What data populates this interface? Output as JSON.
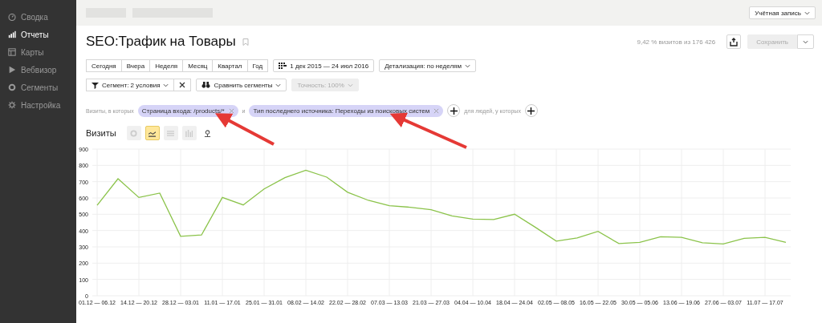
{
  "sidebar": {
    "items": [
      {
        "label": "Сводка",
        "selected": false
      },
      {
        "label": "Отчеты",
        "selected": true
      },
      {
        "label": "Карты",
        "selected": false
      },
      {
        "label": "Вебвизор",
        "selected": false
      },
      {
        "label": "Сегменты",
        "selected": false
      },
      {
        "label": "Настройка",
        "selected": false
      }
    ]
  },
  "header": {
    "account_button": "Учётная запись"
  },
  "report": {
    "title": "SEO:Трафик на Товары",
    "visits_share": "9,42 % визитов из 176 426",
    "save_button": {
      "label": "Сохранить",
      "disabled": true
    }
  },
  "periods": [
    {
      "label": "Сегодня",
      "selected": false
    },
    {
      "label": "Вчера",
      "selected": false
    },
    {
      "label": "Неделя",
      "selected": false
    },
    {
      "label": "Месяц",
      "selected": false
    },
    {
      "label": "Квартал",
      "selected": false
    },
    {
      "label": "Год",
      "selected": false
    }
  ],
  "date_range": "1 дек 2015 — 24 июл 2016",
  "detail": "Детализация: по неделям",
  "segment": "Сегмент: 2 условия",
  "compare": "Сравнить сегменты",
  "accuracy": {
    "label": "Точность: 100%",
    "disabled": true
  },
  "filter": {
    "prefix": "Визиты, в которых",
    "conditions": [
      "Страница входа: /products/*",
      "Тип последнего источника: Переходы из поисковых систем"
    ],
    "joiner": "и",
    "people_label": "для людей, у которых"
  },
  "chart": {
    "title": "Визиты",
    "view_modes": [
      {
        "selected": false,
        "disabled": true
      },
      {
        "selected": true,
        "disabled": false
      },
      {
        "selected": false,
        "disabled": true
      },
      {
        "selected": false,
        "disabled": true
      },
      {
        "selected": false,
        "disabled": false
      }
    ],
    "chart_data": {
      "type": "line",
      "categories": [
        "01.12 — 06.12",
        null,
        "14.12 — 20.12",
        null,
        "28.12 — 03.01",
        null,
        "11.01 — 17.01",
        null,
        "25.01 — 31.01",
        null,
        "08.02 — 14.02",
        null,
        "22.02 — 28.02",
        null,
        "07.03 — 13.03",
        null,
        "21.03 — 27.03",
        null,
        "04.04 — 10.04",
        null,
        "18.04 — 24.04",
        null,
        "02.05 — 08.05",
        null,
        "16.05 — 22.05",
        null,
        "30.05 — 05.06",
        null,
        "13.06 — 19.06",
        null,
        "27.06 — 03.07",
        null,
        "11.07 — 17.07",
        null
      ],
      "grid": true,
      "series": [
        {
          "color": "#8bc34a",
          "values": [
            555,
            718,
            603,
            630,
            365,
            373,
            603,
            557,
            655,
            725,
            770,
            728,
            635,
            585,
            553,
            543,
            528,
            490,
            470,
            468,
            500,
            420,
            335,
            355,
            395,
            320,
            328,
            362,
            358,
            325,
            318,
            352,
            358,
            328
          ]
        }
      ],
      "ylim": [
        0,
        900
      ],
      "yticks": [
        0,
        100,
        200,
        300,
        400,
        500,
        600,
        700,
        800,
        900
      ]
    }
  }
}
